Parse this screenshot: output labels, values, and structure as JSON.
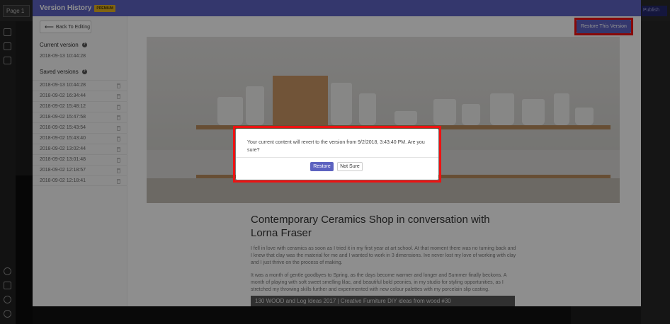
{
  "editor": {
    "page_selector": "Page 1",
    "publish_label": "Publish"
  },
  "modal": {
    "title": "Version History",
    "badge": "PREMIUM",
    "back_label": "Back To Editing",
    "restore_version_label": "Restore This Version"
  },
  "sidebar": {
    "current_title": "Current version",
    "current_version": "2018-09-13 10:44:28",
    "saved_title": "Saved versions",
    "saved_versions": [
      "2018-09-13 10:44:28",
      "2018-09-02 16:34:44",
      "2018-09-02 15:48:12",
      "2018-09-02 15:47:58",
      "2018-09-02 15:43:54",
      "2018-09-02 15:43:40",
      "2018-09-02 13:02:44",
      "2018-09-02 13:01:48",
      "2018-09-02 12:18:57",
      "2018-09-02 12:18:41"
    ]
  },
  "article": {
    "title": "Contemporary Ceramics Shop in conversation with Lorna Fraser",
    "p1": "I fell in love with ceramics as soon as I tried it in my first year at art school. At that moment there was no turning back and I knew that clay was the material for me and I wanted to work in 3 dimensions. Ive never lost my love of working with clay and I just thrive on the process of making.",
    "p2": "It was a month of gentle goodbyes to Spring, as the days become warmer and longer and Summer finally beckons. A month of playing with soft sweet smelling lilac, and beautiful bold peonies, in my studio for styling opportunities, as I stretched my throwing skills further and experimented with new colour palettes with my porcelain slip casting.",
    "video_title": "130 WOOD and Log Ideas 2017 | Creative Furniture DIY ideas from wood #30"
  },
  "dialog": {
    "message": "Your current content will revert to the version from 9/2/2018, 3:43:40 PM. Are you sure?",
    "confirm_label": "Restore",
    "cancel_label": "Not Sure"
  },
  "colors": {
    "accent": "#5c62c0",
    "highlight": "#ee1111",
    "badge": "#e3b01e"
  }
}
